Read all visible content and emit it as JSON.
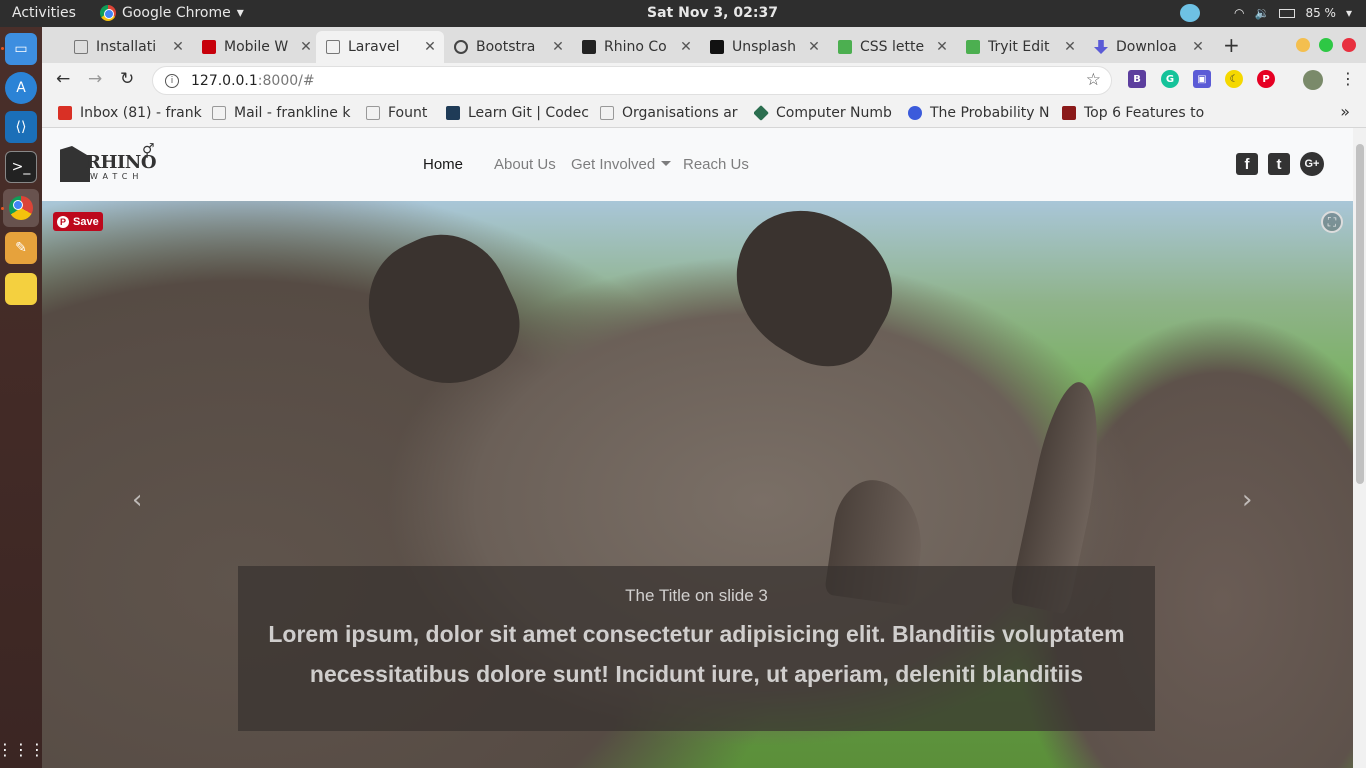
{
  "system": {
    "activities": "Activities",
    "app_name": "Google Chrome",
    "clock": "Sat Nov  3, 02:37",
    "battery": "85 %"
  },
  "tabs": [
    {
      "label": "Installati",
      "color": "#777",
      "active": false
    },
    {
      "label": "Mobile W",
      "color": "#c7000b",
      "active": false
    },
    {
      "label": "Laravel",
      "color": "#777",
      "active": true
    },
    {
      "label": "Bootstra",
      "color": "#444",
      "active": false
    },
    {
      "label": "Rhino Co",
      "color": "#222",
      "active": false
    },
    {
      "label": "Unsplash",
      "color": "#111",
      "active": false
    },
    {
      "label": "CSS lette",
      "color": "#4caf50",
      "active": false
    },
    {
      "label": "Tryit Edit",
      "color": "#4caf50",
      "active": false
    },
    {
      "label": "Downloa",
      "color": "#5b5bd6",
      "active": false
    }
  ],
  "omnibox": {
    "host": "127.0.0.1",
    "path": ":8000/#"
  },
  "bookmarks": [
    {
      "label": "Inbox (81) - frank",
      "color": "#d93025"
    },
    {
      "label": "Mail - frankline k",
      "color": "#999"
    },
    {
      "label": "Fount",
      "color": "#999"
    },
    {
      "label": "Learn Git | Codec",
      "color": "#1f3b57"
    },
    {
      "label": "Organisations ar",
      "color": "#999"
    },
    {
      "label": "Computer Numb",
      "color": "#2b6e4f"
    },
    {
      "label": "The Probability N",
      "color": "#3b5bdb"
    },
    {
      "label": "Top 6 Features to",
      "color": "#8b1a1a"
    }
  ],
  "site": {
    "logo_word": "RHINO",
    "logo_sub": "WATCH",
    "nav": [
      {
        "label": "Home",
        "active": true
      },
      {
        "label": "About Us",
        "active": false
      },
      {
        "label": "Get Involved",
        "active": false,
        "dropdown": true
      },
      {
        "label": "Reach Us",
        "active": false
      }
    ],
    "social": [
      "facebook-icon",
      "twitter-icon",
      "google-plus-icon"
    ],
    "pin_save": "Save",
    "slide": {
      "title": "The Title on slide 3",
      "text": "Lorem ipsum, dolor sit amet consectetur adipisicing elit. Blanditiis voluptatem necessitatibus dolore sunt! Incidunt iure, ut aperiam, deleniti blanditiis"
    }
  }
}
